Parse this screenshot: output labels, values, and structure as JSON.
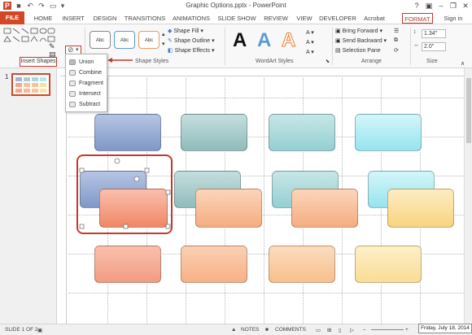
{
  "window": {
    "title": "Graphic Options.pptx - PowerPoint",
    "sign_in": "Sign in"
  },
  "tabs": [
    "FILE",
    "HOME",
    "INSERT",
    "DESIGN",
    "TRANSITIONS",
    "ANIMATIONS",
    "SLIDE SHOW",
    "REVIEW",
    "VIEW",
    "DEVELOPER",
    "Acrobat",
    "FORMAT"
  ],
  "ribbon": {
    "insert_shapes_label": "Insert Shapes",
    "shape_styles_label": "Shape Styles",
    "style_thumb_text": "Abc",
    "shape_fill": "Shape Fill",
    "shape_outline": "Shape Outline",
    "shape_effects": "Shape Effects",
    "wordart_label": "WordArt Styles",
    "wordart_letter": "A",
    "bring_forward": "Bring Forward",
    "send_backward": "Send Backward",
    "selection_pane": "Selection Pane",
    "arrange_label": "Arrange",
    "height_value": "1.34\"",
    "width_value": "2.0\"",
    "size_label": "Size"
  },
  "merge_menu": [
    "Union",
    "Combine",
    "Fragment",
    "Intersect",
    "Subtract"
  ],
  "slides_pane": {
    "slide_number": "1"
  },
  "status": {
    "slide_info": "SLIDE 1 OF 2",
    "notes": "NOTES",
    "comments": "COMMENTS",
    "date_tooltip": "Friday, July 18, 2014"
  },
  "colors": {
    "accent": "#d24726",
    "highlight": "#c0392b"
  }
}
